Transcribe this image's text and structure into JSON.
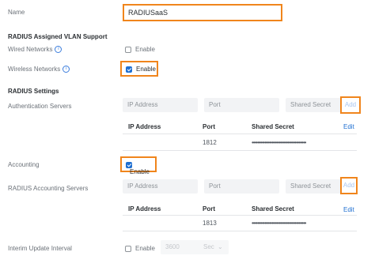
{
  "name": {
    "label": "Name",
    "value": "RADIUSaaS"
  },
  "vlan": {
    "section_title": "RADIUS Assigned VLAN Support",
    "wired": {
      "label": "Wired Networks",
      "info_icon": "i",
      "checkbox_label": "Enable",
      "checked": false
    },
    "wireless": {
      "label": "Wireless Networks",
      "info_icon": "i",
      "checkbox_label": "Enable",
      "checked": true
    }
  },
  "settings": {
    "section_title": "RADIUS Settings",
    "auth": {
      "label": "Authentication Servers",
      "ip_placeholder": "IP Address",
      "port_placeholder": "Port",
      "secret_placeholder": "Shared Secret",
      "add_label": "Add",
      "columns": [
        "IP Address",
        "Port",
        "Shared Secret"
      ],
      "edit_label": "Edit",
      "rows": [
        {
          "ip": "",
          "port": "1812",
          "secret": "••••••••••••••••••••••••••••••••••••••"
        }
      ]
    },
    "accounting": {
      "label": "Accounting",
      "checkbox_label": "Enable",
      "checked": true
    },
    "acct_servers": {
      "label": "RADIUS Accounting Servers",
      "ip_placeholder": "IP Address",
      "port_placeholder": "Port",
      "secret_placeholder": "Shared Secret",
      "add_label": "Add",
      "columns": [
        "IP Address",
        "Port",
        "Shared Secret"
      ],
      "edit_label": "Edit",
      "rows": [
        {
          "ip": "",
          "port": "1813",
          "secret": "••••••••••••••••••••••••••••••••••••••"
        }
      ]
    },
    "interim": {
      "label": "Interim Update Interval",
      "checkbox_label": "Enable",
      "checked": false,
      "value": "3600",
      "unit": "Sec"
    }
  },
  "colors": {
    "accent": "#1f6fd1",
    "highlight": "#f0851c"
  }
}
